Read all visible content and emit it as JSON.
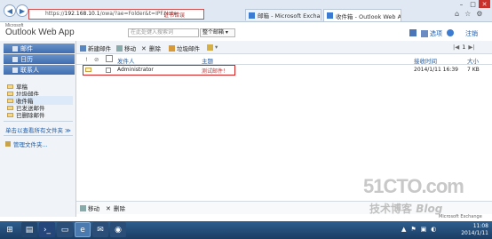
{
  "browser": {
    "url_prefix": "https://",
    "url_host": "192.168.10.1",
    "url_rest": "/owa/?ae=Folder&t=IPF.Note",
    "security_label": "证书错误",
    "tabs": [
      {
        "label": "邮箱 - Microsoft Exchange"
      },
      {
        "label": "收件箱 - Outlook Web Ap..."
      }
    ]
  },
  "owa": {
    "ms_brand": "Microsoft",
    "app_name": "Outlook Web App",
    "search_placeholder": "在此处键入搜索词",
    "search_scope": "整个邮箱",
    "options_label": "选项",
    "signout_label": "注销"
  },
  "nav": {
    "mail": "邮件",
    "calendar": "日历",
    "contacts": "联系人",
    "folders": [
      "草稿",
      "垃圾邮件",
      "收件箱",
      "已发送邮件",
      "已删除邮件"
    ],
    "selected_index": 2,
    "more_folders": "单击以查看所有文件夹 ≫",
    "manage_folders": "管理文件夹..."
  },
  "toolbar": {
    "new_mail": "新建邮件",
    "move": "移动",
    "delete": "删除",
    "junk": "垃圾邮件",
    "page": "1"
  },
  "list": {
    "col_from": "发件人",
    "col_subject": "主题",
    "col_received": "接收时间",
    "col_size": "大小",
    "rows": [
      {
        "from": "Administrator",
        "subject": "测试邮件！",
        "received": "2014/1/11 16:39",
        "size": "7 KB"
      }
    ]
  },
  "bottom_toolbar": {
    "move": "移动",
    "delete": "删除"
  },
  "watermark": {
    "line1": "51CTO.com",
    "line2": "技术博客",
    "line3": "Blog",
    "line4": "Microsoft Exchange"
  },
  "taskbar": {
    "time": "11:08",
    "date": "2014/1/11"
  }
}
